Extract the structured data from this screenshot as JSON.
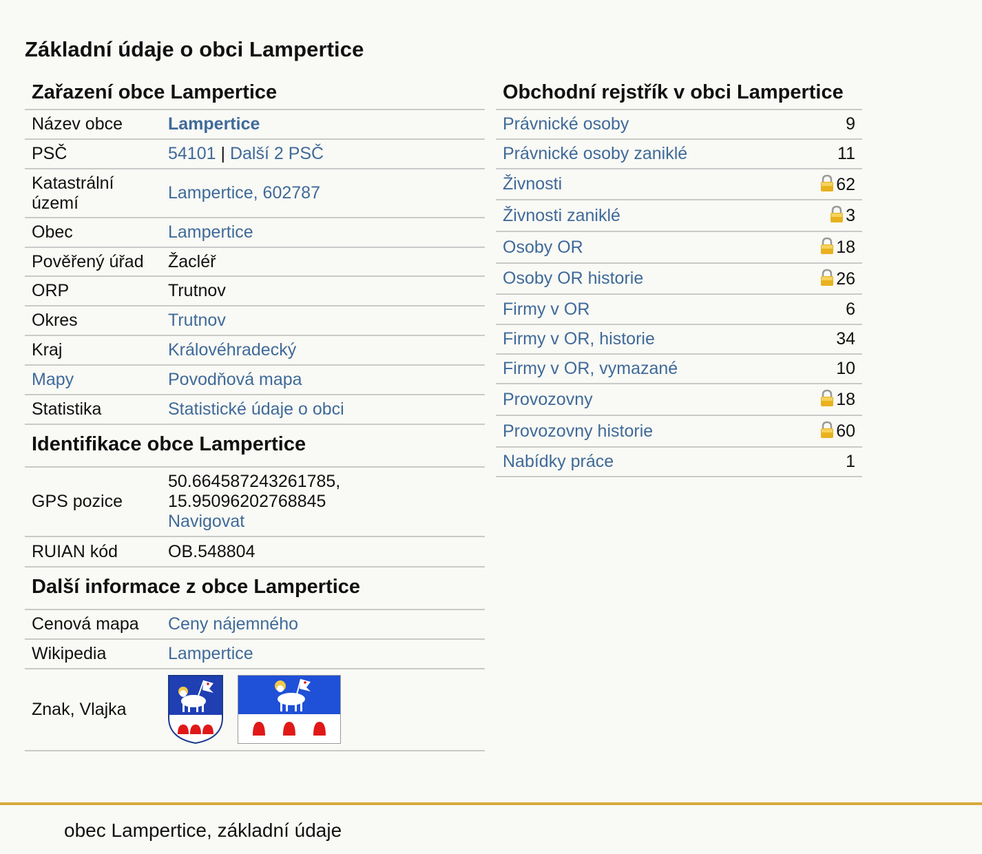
{
  "page_title": "Základní údaje o obci Lampertice",
  "zarazeni": {
    "title": "Zařazení obce Lampertice",
    "nazev_label": "Název obce",
    "nazev_value": "Lampertice",
    "psc_label": "PSČ",
    "psc_value": "54101",
    "psc_separator": "|",
    "psc_more": "Další 2 PSČ",
    "katastr_label_line1": "Katastrální",
    "katastr_label_line2": "území",
    "katastr_value": "Lampertice, 602787",
    "obec_label": "Obec",
    "obec_value": "Lampertice",
    "urad_label": "Pověřený úřad",
    "urad_value": "Žacléř",
    "orp_label": "ORP",
    "orp_value": "Trutnov",
    "okres_label": "Okres",
    "okres_value": "Trutnov",
    "kraj_label": "Kraj",
    "kraj_value": "Královéhradecký",
    "mapy_label": "Mapy",
    "mapy_value": "Povodňová mapa",
    "statistika_label": "Statistika",
    "statistika_value": "Statistické údaje o obci"
  },
  "identifikace": {
    "title": "Identifikace obce Lampertice",
    "gps_label": "GPS pozice",
    "gps_lat": "50.664587243261785,",
    "gps_lon": "15.95096202768845",
    "gps_nav": "Navigovat",
    "ruian_label": "RUIAN kód",
    "ruian_value": "OB.548804"
  },
  "dalsi": {
    "title": "Další informace z obce Lampertice",
    "cenova_label": "Cenová mapa",
    "cenova_value": "Ceny nájemného",
    "wiki_label": "Wikipedia",
    "wiki_value": "Lampertice",
    "znak_label": "Znak, Vlajka"
  },
  "rejstrik": {
    "title": "Obchodní rejstřík v obci Lampertice",
    "rows": [
      {
        "label": "Právnické osoby",
        "count": "9",
        "locked": false
      },
      {
        "label": "Právnické osoby zaniklé",
        "count": "11",
        "locked": false
      },
      {
        "label": "Živnosti",
        "count": "62",
        "locked": true
      },
      {
        "label": "Živnosti zaniklé",
        "count": "3",
        "locked": true
      },
      {
        "label": "Osoby OR",
        "count": "18",
        "locked": true
      },
      {
        "label": "Osoby OR historie",
        "count": "26",
        "locked": true
      },
      {
        "label": "Firmy v OR",
        "count": "6",
        "locked": false
      },
      {
        "label": "Firmy v OR, historie",
        "count": "34",
        "locked": false
      },
      {
        "label": "Firmy v OR, vymazané",
        "count": "10",
        "locked": false
      },
      {
        "label": "Provozovny",
        "count": "18",
        "locked": true
      },
      {
        "label": "Provozovny historie",
        "count": "60",
        "locked": true
      },
      {
        "label": "Nabídky práce",
        "count": "1",
        "locked": false
      }
    ]
  },
  "footer": "obec Lampertice, základní údaje",
  "colors": {
    "link": "#3f6a99",
    "footer_line": "#d7aa3a",
    "background": "#f9f9f5",
    "divider": "#c9c9c9"
  },
  "icons": {
    "lock": "lock-icon",
    "coat_of_arms": "coat-of-arms-icon",
    "flag": "flag-icon"
  }
}
